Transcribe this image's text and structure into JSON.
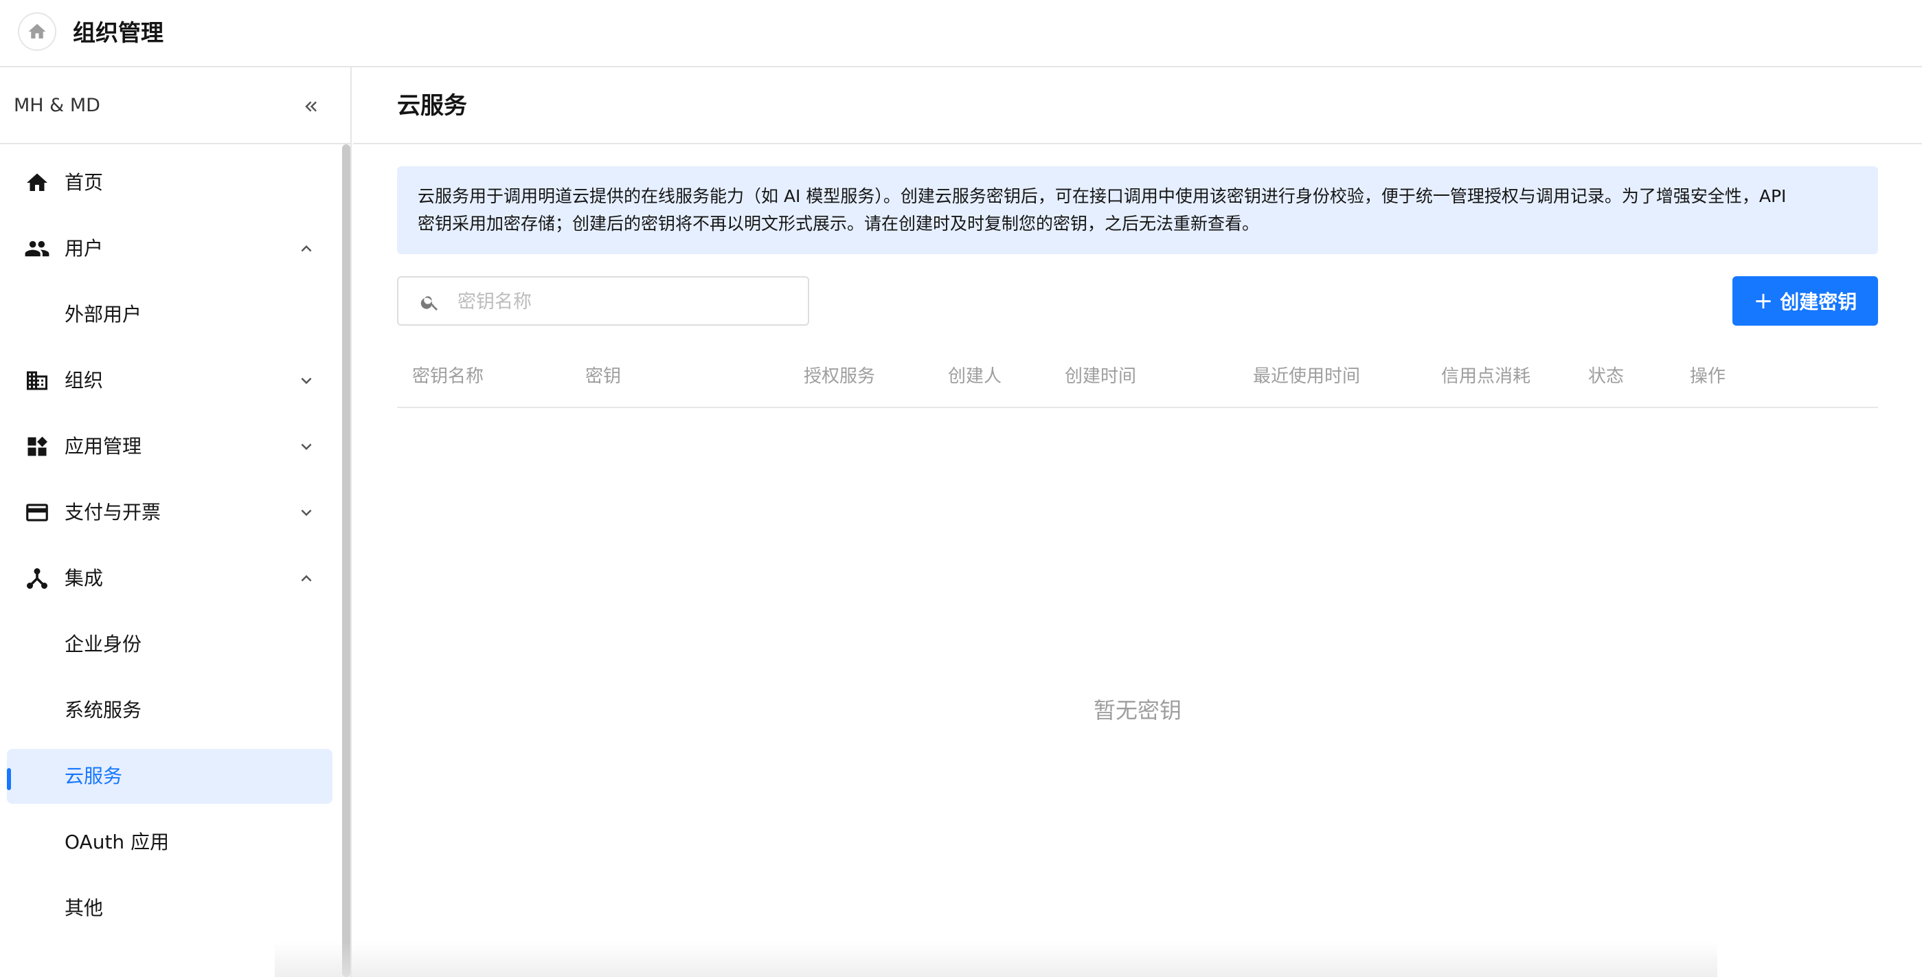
{
  "header": {
    "home_icon": "home-icon",
    "title": "组织管理"
  },
  "sidebar": {
    "org_name": "MH & MD",
    "collapse_icon": "double-chevron-left-icon",
    "items": [
      {
        "label": "首页",
        "icon": "home-icon"
      },
      {
        "label": "用户",
        "icon": "users-icon",
        "expanded": true
      },
      {
        "label": "外部用户",
        "sub": true
      },
      {
        "label": "组织",
        "icon": "building-icon",
        "expanded": false
      },
      {
        "label": "应用管理",
        "icon": "apps-icon",
        "expanded": false
      },
      {
        "label": "支付与开票",
        "icon": "credit-card-icon",
        "expanded": false
      },
      {
        "label": "集成",
        "icon": "integration-icon",
        "expanded": true
      },
      {
        "label": "企业身份",
        "sub": true
      },
      {
        "label": "系统服务",
        "sub": true
      },
      {
        "label": "云服务",
        "sub": true,
        "active": true
      },
      {
        "label": "OAuth 应用",
        "sub": true
      },
      {
        "label": "其他",
        "sub": true
      }
    ]
  },
  "main": {
    "title": "云服务",
    "notice_line1": "云服务用于调用明道云提供的在线服务能力（如 AI 模型服务）。创建云服务密钥后，可在接口调用中使用该密钥进行身份校验，便于统一管理授权与调用记录。为了增强安全性，API",
    "notice_line2": "密钥采用加密存储；创建后的密钥将不再以明文形式展示。请在创建时及时复制您的密钥，之后无法重新查看。",
    "search_placeholder": "密钥名称",
    "create_button": "创建密钥",
    "columns": [
      "密钥名称",
      "密钥",
      "授权服务",
      "创建人",
      "创建时间",
      "最近使用时间",
      "信用点消耗",
      "状态",
      "操作"
    ],
    "empty_text": "暂无密钥"
  },
  "colors": {
    "accent": "#1677ff",
    "active_bg": "#e6efff",
    "notice_bg": "#e6efff"
  }
}
